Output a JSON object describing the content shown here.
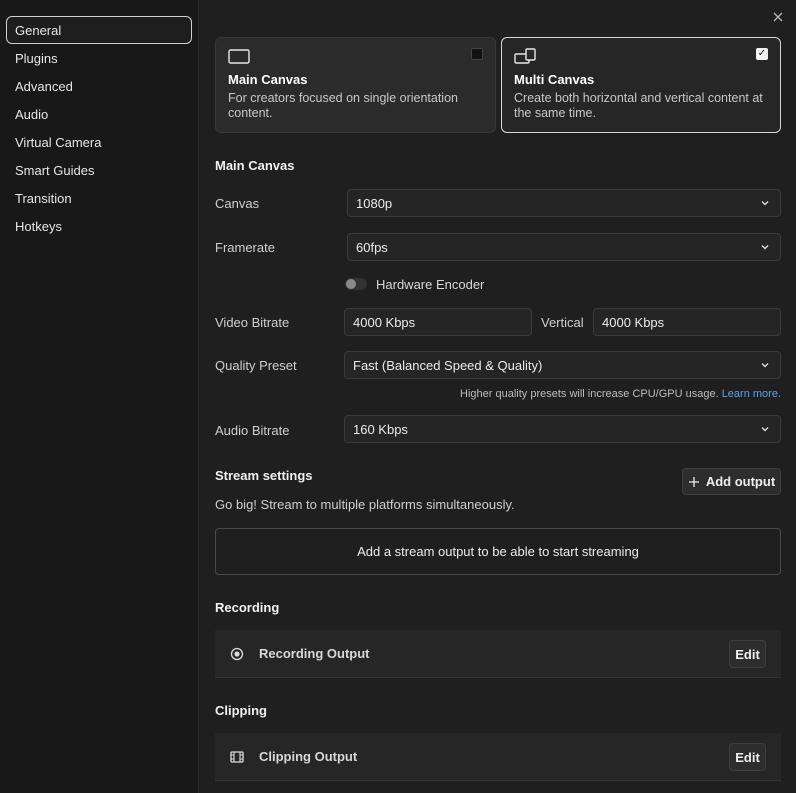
{
  "sidebar": {
    "items": [
      {
        "label": "General",
        "active": true
      },
      {
        "label": "Plugins"
      },
      {
        "label": "Advanced"
      },
      {
        "label": "Audio"
      },
      {
        "label": "Virtual Camera"
      },
      {
        "label": "Smart Guides"
      },
      {
        "label": "Transition"
      },
      {
        "label": "Hotkeys"
      }
    ]
  },
  "close_icon": "close-icon",
  "canvas_modes": [
    {
      "title": "Main Canvas",
      "description": "For creators focused on single orientation content.",
      "checked": false
    },
    {
      "title": "Multi Canvas",
      "description": "Create both horizontal and vertical content at the same time.",
      "checked": true
    }
  ],
  "main_canvas": {
    "heading": "Main Canvas",
    "canvas_label": "Canvas",
    "canvas_value": "1080p",
    "framerate_label": "Framerate",
    "framerate_value": "60fps",
    "hardware_encoder_label": "Hardware Encoder",
    "hardware_encoder_on": false,
    "video_bitrate_label": "Video Bitrate",
    "video_bitrate_value": "4000 Kbps",
    "vertical_label": "Vertical",
    "vertical_value": "4000 Kbps",
    "quality_preset_label": "Quality Preset",
    "quality_preset_value": "Fast (Balanced Speed & Quality)",
    "quality_hint": "Higher quality presets will increase CPU/GPU usage.",
    "learn_more": "Learn more.",
    "audio_bitrate_label": "Audio Bitrate",
    "audio_bitrate_value": "160 Kbps"
  },
  "stream": {
    "heading": "Stream settings",
    "subtitle": "Go big! Stream to multiple platforms simultaneously.",
    "add_output_label": "Add output",
    "empty_message": "Add a stream output to be able to start streaming"
  },
  "recording": {
    "heading": "Recording",
    "output_label": "Recording Output",
    "edit_label": "Edit"
  },
  "clipping": {
    "heading": "Clipping",
    "output_label": "Clipping Output",
    "edit_label": "Edit"
  },
  "colors": {
    "link": "#5aa3e8",
    "background": "#1f1f1f",
    "sidebar": "#181818"
  }
}
